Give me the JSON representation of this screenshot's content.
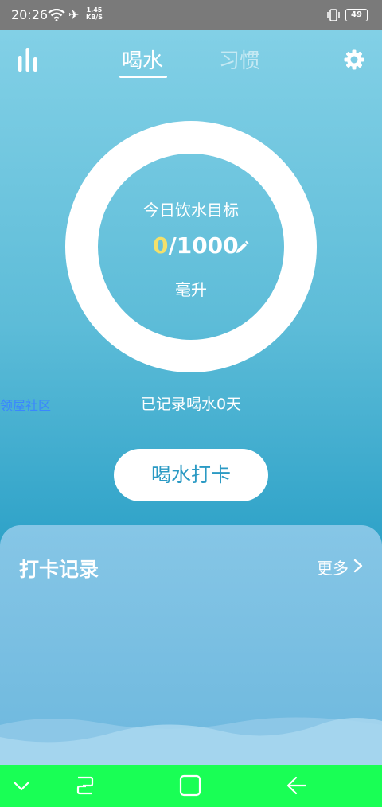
{
  "status_bar": {
    "time": "20:26",
    "net_speed_value": "1.45",
    "net_speed_unit": "KB/S",
    "battery": "49"
  },
  "tabs": {
    "drink": "喝水",
    "habit": "习惯"
  },
  "goal": {
    "title": "今日饮水目标",
    "current": "0",
    "target": "/1000",
    "unit": "毫升"
  },
  "community_link": "领屋社区",
  "recorded_days": "已记录喝水0天",
  "checkin_button": "喝水打卡",
  "records": {
    "title": "打卡记录",
    "more": "更多"
  },
  "colors": {
    "accent": "#2b9ac4",
    "value_highlight": "#f3e06a",
    "nav_bar": "#19ff55"
  }
}
